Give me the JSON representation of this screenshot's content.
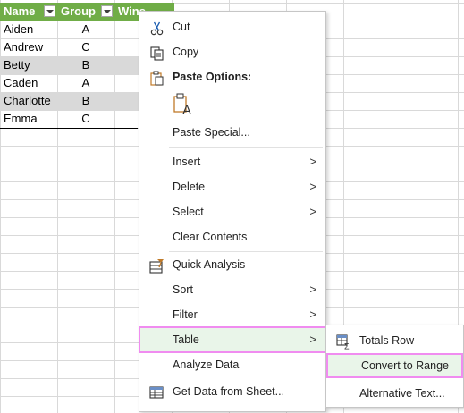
{
  "table": {
    "headers": [
      "Name",
      "Group",
      "Wins"
    ],
    "rows": [
      [
        "Aiden",
        "A"
      ],
      [
        "Andrew",
        "C"
      ],
      [
        "Betty",
        "B"
      ],
      [
        "Caden",
        "A"
      ],
      [
        "Charlotte",
        "B"
      ],
      [
        "Emma",
        "C"
      ]
    ]
  },
  "menu": {
    "cut": "Cut",
    "copy": "Copy",
    "paste_options": "Paste Options:",
    "paste_special": "Paste Special...",
    "insert": "Insert",
    "delete": "Delete",
    "select": "Select",
    "clear_contents": "Clear Contents",
    "quick_analysis": "Quick Analysis",
    "sort": "Sort",
    "filter": "Filter",
    "table": "Table",
    "analyze_data": "Analyze Data",
    "get_data": "Get Data from Sheet...",
    "arrow": ">"
  },
  "submenu": {
    "totals_row": "Totals Row",
    "convert_to_range": "Convert to Range",
    "alternative_text": "Alternative Text..."
  },
  "colors": {
    "header_green": "#70ad47",
    "band_gray": "#d9d9d9",
    "highlight_border": "#f08cf0",
    "highlight_fill": "#e9f5e9"
  }
}
